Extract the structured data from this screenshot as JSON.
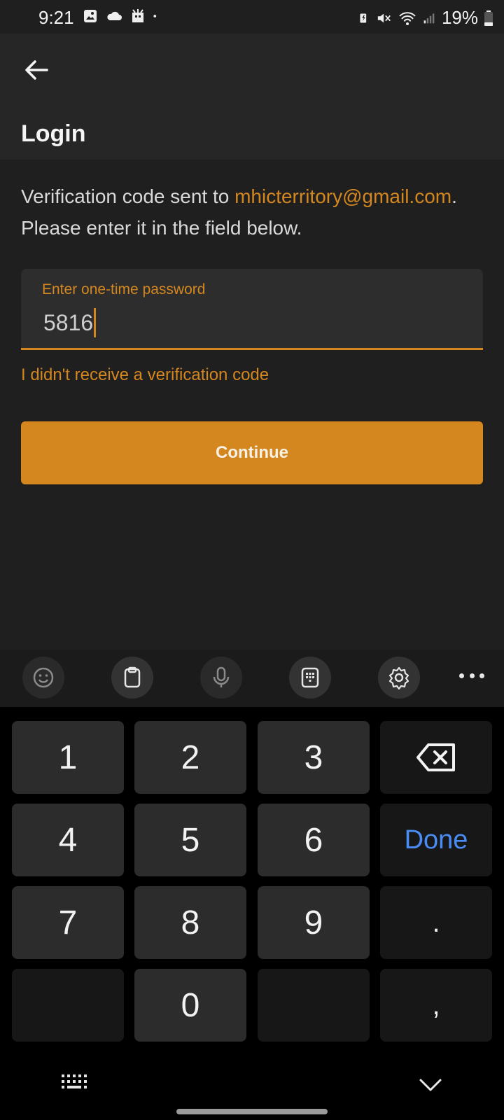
{
  "status_bar": {
    "time": "9:21",
    "battery_text": "19%"
  },
  "app_bar": {
    "title": "Login"
  },
  "message": {
    "prefix": "Verification code sent to ",
    "email": "mhicterritory@gmail.com",
    "suffix": ". Please enter it in the field below."
  },
  "otp_field": {
    "label": "Enter one-time password",
    "value": "5816"
  },
  "resend_link": "I didn't receive a verification code",
  "continue_button": "Continue",
  "keyboard": {
    "keys": {
      "k1": "1",
      "k2": "2",
      "k3": "3",
      "k4": "4",
      "k5": "5",
      "k6": "6",
      "done": "Done",
      "k7": "7",
      "k8": "8",
      "k9": "9",
      "dot": ".",
      "k0": "0",
      "comma": ","
    }
  },
  "colors": {
    "accent": "#d4861f",
    "background": "#1f1f1f",
    "app_bar": "#262626",
    "done_key": "#4a8cf5"
  }
}
